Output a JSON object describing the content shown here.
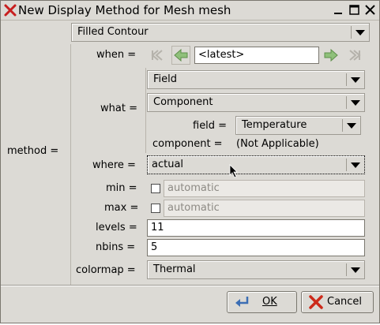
{
  "window": {
    "title": "New Display Method for Mesh mesh",
    "icon": "close-x-icon",
    "controls": [
      "minimize-icon",
      "maximize-icon",
      "close-icon"
    ]
  },
  "form": {
    "method_label": "method =",
    "method_value": "Filled Contour",
    "when_label": "when =",
    "when_value": "<latest>",
    "what_label": "what =",
    "what_type": "Field",
    "what_kind": "Component",
    "field_label": "field =",
    "field_value": "Temperature",
    "component_label": "component =",
    "component_value": "(Not Applicable)",
    "where_label": "where =",
    "where_value": "actual",
    "min_label": "min =",
    "min_value": "automatic",
    "max_label": "max =",
    "max_value": "automatic",
    "levels_label": "levels =",
    "levels_value": "11",
    "nbins_label": "nbins =",
    "nbins_value": "5",
    "colormap_label": "colormap =",
    "colormap_value": "Thermal"
  },
  "buttons": {
    "ok_label": "OK",
    "cancel_label": "Cancel"
  },
  "colors": {
    "background": "#dcdad5",
    "nav_arrow": "#5fa84a",
    "cancel_icon": "#cc2a1a",
    "ok_icon": "#3c6eb4"
  }
}
